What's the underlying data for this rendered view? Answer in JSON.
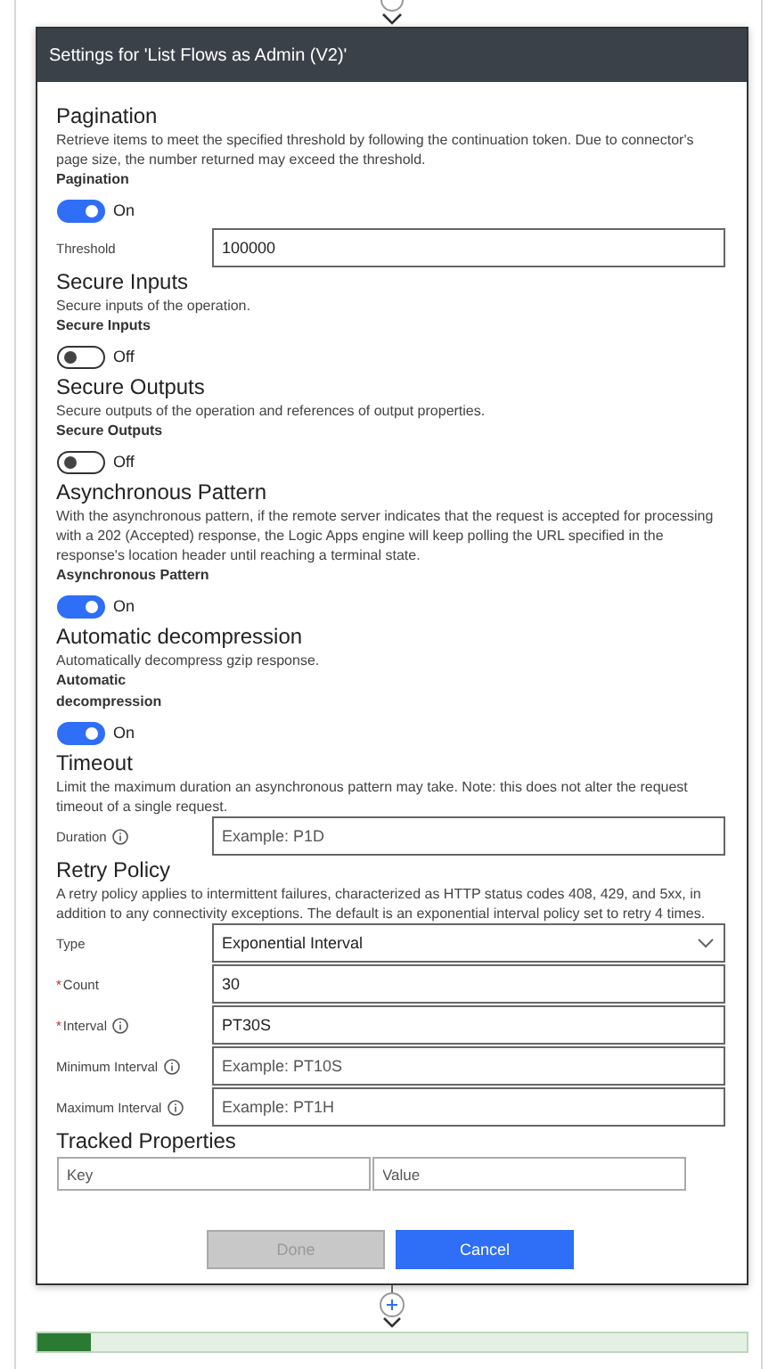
{
  "dialog": {
    "title": "Settings for 'List Flows as Admin (V2)'",
    "sections": [
      {
        "title": "Pagination",
        "description": "Retrieve items to meet the specified threshold by following the continuation token. Due to connector's page size, the number returned may exceed the threshold.",
        "controls": [
          {
            "kind": "toggle",
            "label": "Pagination",
            "on": true,
            "state_text": "On"
          },
          {
            "kind": "field",
            "label": "Threshold",
            "info": false,
            "value": "100000"
          }
        ]
      },
      {
        "title": "Secure Inputs",
        "description": "Secure inputs of the operation.",
        "controls": [
          {
            "kind": "toggle",
            "label": "Secure Inputs",
            "on": false,
            "state_text": "Off"
          }
        ]
      },
      {
        "title": "Secure Outputs",
        "description": "Secure outputs of the operation and references of output properties.",
        "controls": [
          {
            "kind": "toggle",
            "label": "Secure Outputs",
            "on": false,
            "state_text": "Off"
          }
        ]
      },
      {
        "title": "Asynchronous Pattern",
        "description": "With the asynchronous pattern, if the remote server indicates that the request is accepted for processing with a 202 (Accepted) response, the Logic Apps engine will keep polling the URL specified in the response's location header until reaching a terminal state.",
        "controls": [
          {
            "kind": "toggle",
            "label": "Asynchronous Pattern",
            "on": true,
            "state_text": "On"
          }
        ]
      },
      {
        "title": "Automatic decompression",
        "description": "Automatically decompress gzip response.",
        "controls": [
          {
            "kind": "toggle",
            "label": "Automatic decompression",
            "on": true,
            "state_text": "On"
          }
        ]
      },
      {
        "title": "Timeout",
        "description": "Limit the maximum duration an asynchronous pattern may take. Note: this does not alter the request timeout of a single request.",
        "controls": [
          {
            "kind": "field",
            "label": "Duration",
            "info": true,
            "placeholder": "Example: P1D"
          }
        ]
      },
      {
        "title": "Retry Policy",
        "description": "A retry policy applies to intermittent failures, characterized as HTTP status codes 408, 429, and 5xx, in addition to any connectivity exceptions. The default is an exponential interval policy set to retry 4 times.",
        "controls": [
          {
            "kind": "select",
            "label": "Type",
            "value": "Exponential Interval"
          },
          {
            "kind": "field",
            "required_mark": "*",
            "label": "Count",
            "info": false,
            "value": "30"
          },
          {
            "kind": "field",
            "required_mark": "*",
            "label": "Interval",
            "info": true,
            "value": "PT30S"
          },
          {
            "kind": "field",
            "label": "Minimum Interval",
            "info": true,
            "placeholder": "Example: PT10S"
          },
          {
            "kind": "field",
            "label": "Maximum Interval",
            "info": true,
            "placeholder": "Example: PT1H"
          }
        ]
      },
      {
        "title": "Tracked Properties",
        "controls": [
          {
            "kind": "kv",
            "key_placeholder": "Key",
            "value_placeholder": "Value"
          }
        ]
      }
    ],
    "buttons": [
      {
        "label": "Done",
        "disabled": true
      },
      {
        "label": "Cancel",
        "disabled": false
      }
    ]
  }
}
